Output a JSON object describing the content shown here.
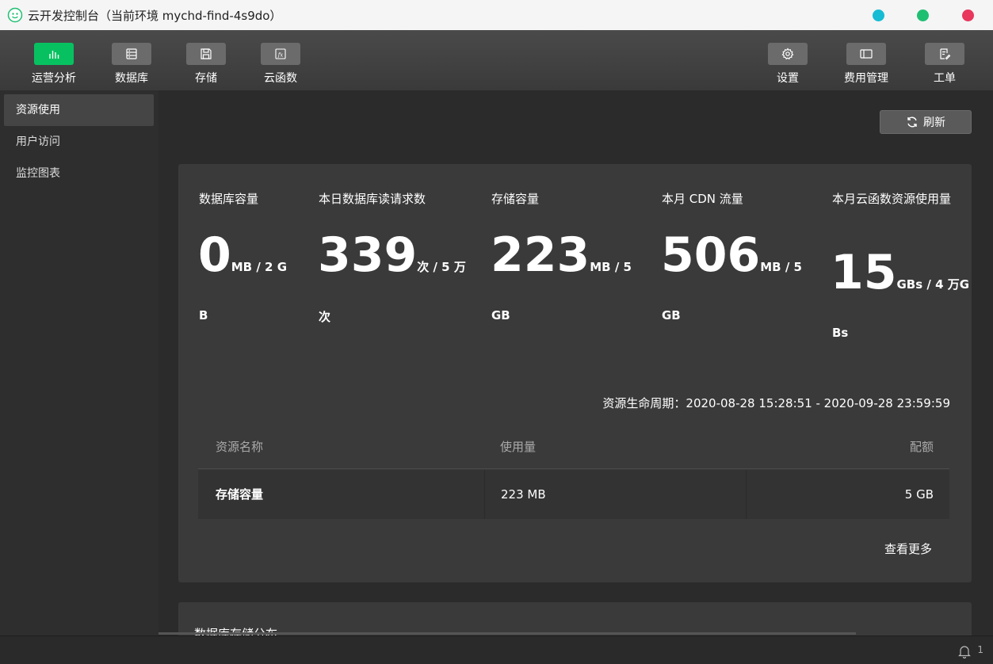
{
  "window": {
    "title": "云开发控制台（当前环境 mychd-find-4s9do）",
    "controls": [
      {
        "name": "minimize",
        "color": "#15bcd3"
      },
      {
        "name": "maximize",
        "color": "#1fbf72"
      },
      {
        "name": "close",
        "color": "#e8365d"
      }
    ]
  },
  "toolbar": {
    "left": [
      {
        "label": "运营分析",
        "icon": "bar-chart-icon",
        "active": true
      },
      {
        "label": "数据库",
        "icon": "database-icon",
        "active": false
      },
      {
        "label": "存储",
        "icon": "storage-icon",
        "active": false
      },
      {
        "label": "云函数",
        "icon": "function-icon",
        "active": false
      }
    ],
    "right": [
      {
        "label": "设置",
        "icon": "gear-icon"
      },
      {
        "label": "费用管理",
        "icon": "billing-icon"
      },
      {
        "label": "工单",
        "icon": "ticket-icon"
      }
    ]
  },
  "sidebar": {
    "items": [
      {
        "label": "资源使用",
        "active": true
      },
      {
        "label": "用户访问",
        "active": false
      },
      {
        "label": "监控图表",
        "active": false
      }
    ]
  },
  "main": {
    "refresh_label": "刷新",
    "stats": [
      {
        "title": "数据库容量",
        "value": "0",
        "unit": "MB / 2 G",
        "unit2": "B"
      },
      {
        "title": "本日数据库读请求数",
        "value": "339",
        "unit": "次 / 5 万",
        "unit2": "次"
      },
      {
        "title": "存储容量",
        "value": "223",
        "unit": "MB / 5",
        "unit2": "GB"
      },
      {
        "title": "本月 CDN 流量",
        "value": "506",
        "unit": "MB / 5",
        "unit2": "GB"
      },
      {
        "title": "本月云函数资源使用量",
        "value": "15",
        "unit": "GBs / 4 万G",
        "unit2": "Bs"
      }
    ],
    "period": "资源生命周期：2020-08-28 15:28:51 - 2020-09-28 23:59:59",
    "table": {
      "columns": [
        "资源名称",
        "使用量",
        "配额"
      ],
      "rows": [
        {
          "name": "存储容量",
          "usage": "223 MB",
          "quota": "5 GB"
        }
      ]
    },
    "more_label": "查看更多",
    "section2_title": "数据库存储分布"
  },
  "status": {
    "notification_count": "1"
  }
}
